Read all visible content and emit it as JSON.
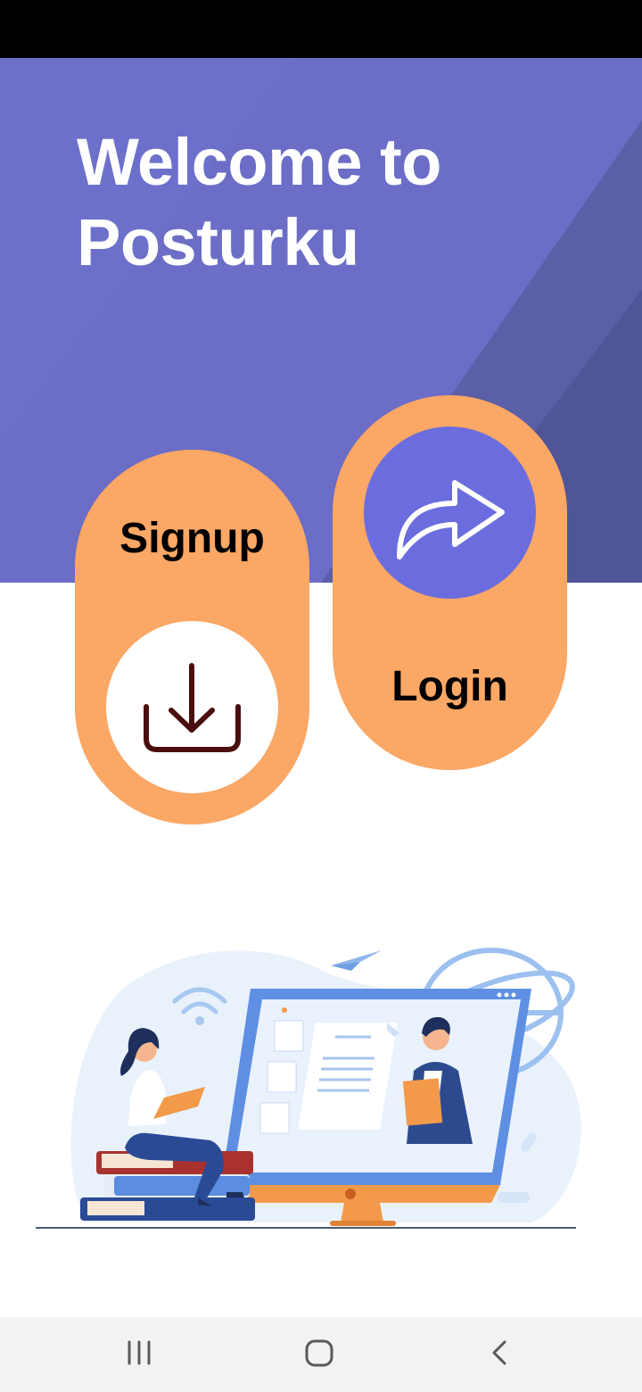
{
  "header": {
    "title_line1": "Welcome to",
    "title_line2": "Posturku"
  },
  "actions": {
    "signup_label": "Signup",
    "login_label": "Login"
  },
  "icons": {
    "signup": "download-icon",
    "login": "share-arrow-icon",
    "nav_recents": "recent-apps-icon",
    "nav_home": "home-icon",
    "nav_back": "back-icon"
  },
  "colors": {
    "hero": "#6b6dc6",
    "button_pill": "#fba765",
    "login_icon_circle": "#6b6ddf",
    "signup_icon_circle": "#ffffff",
    "download_icon": "#4a0e0e"
  }
}
